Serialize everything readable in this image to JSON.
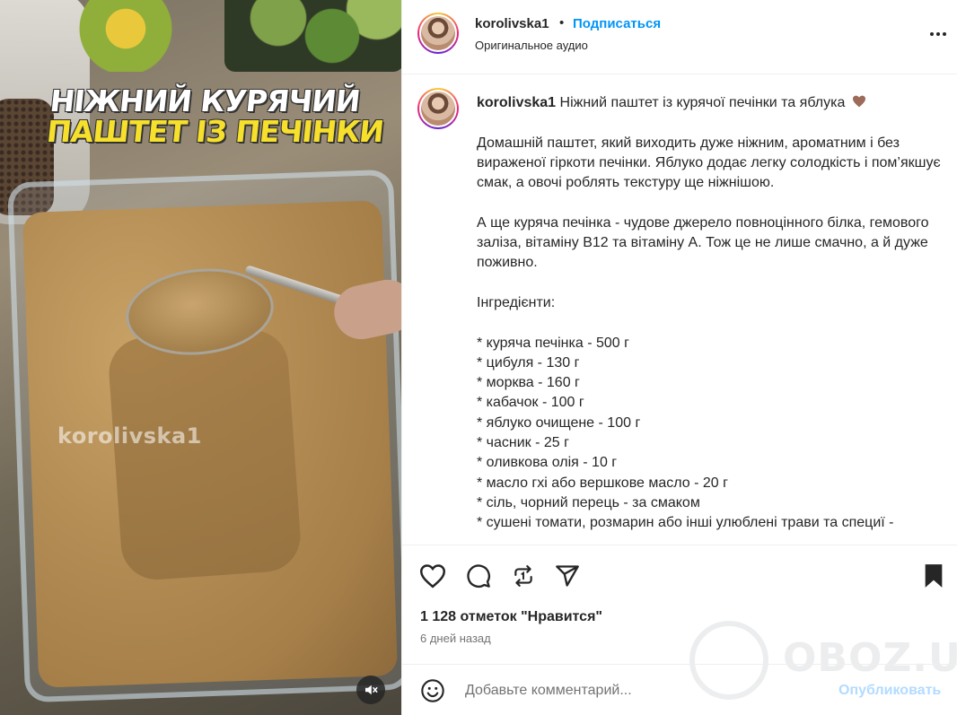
{
  "media": {
    "overlay_line1": "НІЖНИЙ КУРЯЧИЙ",
    "overlay_line2": "ПАШТЕТ ІЗ ПЕЧІНКИ",
    "watermark": "korolivska1",
    "overlay_colors": {
      "line1": "#ffffff",
      "line2": "#f6e02c"
    }
  },
  "header": {
    "username": "korolivska1",
    "separator": "•",
    "follow_label": "Подписаться",
    "audio_label": "Оригинальное аудио"
  },
  "caption": {
    "username": "korolivska1",
    "title": "Ніжний паштет із курячої печінки та яблука",
    "title_emoji": "brown-heart",
    "paragraph1": "Домашній паштет, який виходить дуже ніжним, ароматним і без вираженої гіркоти печінки. Яблуко додає легку солодкість і пом’якшує смак, а овочі роблять текстуру ще ніжнішою.",
    "paragraph2": "А ще куряча печінка - чудове джерело повноцінного білка, гемового заліза, вітаміну B12 та вітаміну А. Тож це не лише смачно, а й дуже поживно.",
    "ingredients_heading": "Інгредієнти:",
    "ingredients": [
      "* куряча печінка - 500 г",
      "* цибуля - 130 г",
      "* морква - 160 г",
      "* кабачок - 100 г",
      "* яблуко очищене - 100 г",
      "* часник - 25 г",
      "* оливкова олія - 10 г",
      "* масло гхі або вершкове масло - 20 г",
      "* сіль, чорний перець - за смаком",
      "* сушені томати, розмарин або інші улюблені трави та специї -"
    ]
  },
  "actions": {
    "icons": [
      "heart-icon",
      "comment-icon",
      "repost-icon",
      "share-icon",
      "bookmark-icon"
    ]
  },
  "stats": {
    "likes": "1 128 отметок \"Нравится\"",
    "time_ago": "6 дней назад"
  },
  "watermark_site": "OBOZ.UA",
  "comment": {
    "placeholder": "Добавьте комментарий...",
    "publish_label": "Опубликовать"
  },
  "colors": {
    "accent": "#0095f6",
    "publish_disabled": "#b3dbff",
    "text": "#262626",
    "muted": "#737373"
  }
}
